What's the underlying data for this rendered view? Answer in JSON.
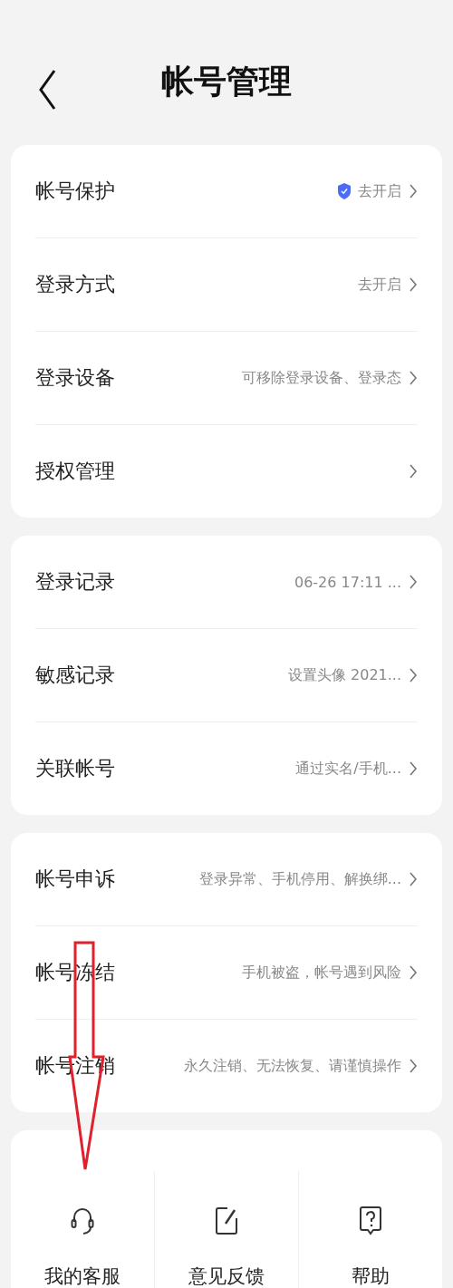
{
  "header": {
    "title": "帐号管理"
  },
  "sections": [
    {
      "rows": [
        {
          "kind": "shield",
          "label": "帐号保护",
          "value": "去开启"
        },
        {
          "kind": "plain",
          "label": "登录方式",
          "value": "去开启"
        },
        {
          "kind": "plain",
          "label": "登录设备",
          "value": "可移除登录设备、登录态"
        },
        {
          "kind": "plain",
          "label": "授权管理"
        }
      ]
    },
    {
      "rows": [
        {
          "kind": "plain",
          "label": "登录记录",
          "value": "06-26 17:11 ..."
        },
        {
          "kind": "plain",
          "label": "敏感记录",
          "value": "设置头像 2021..."
        },
        {
          "kind": "plain",
          "label": "关联帐号",
          "value": "通过实名/手机..."
        }
      ]
    },
    {
      "rows": [
        {
          "kind": "plain",
          "label": "帐号申诉",
          "value": "登录异常、手机停用、解换绑..."
        },
        {
          "kind": "plain",
          "label": "帐号冻结",
          "value": "手机被盗，帐号遇到风险"
        },
        {
          "kind": "plain",
          "label": "帐号注销",
          "value": "永久注销、无法恢复、请谨慎操作"
        }
      ]
    }
  ],
  "actions": [
    {
      "kind": "service",
      "label": "我的客服"
    },
    {
      "kind": "feedback",
      "label": "意见反馈"
    },
    {
      "kind": "help",
      "label": "帮助"
    }
  ]
}
